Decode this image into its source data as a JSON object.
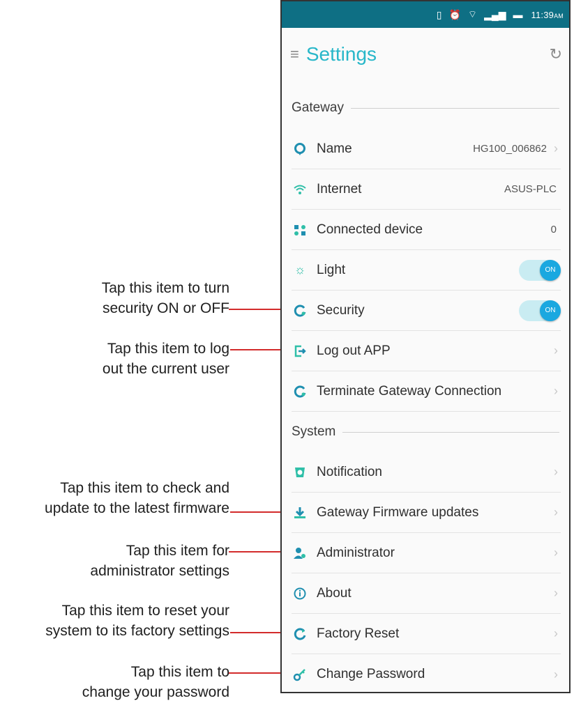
{
  "status_bar": {
    "time": "11:39",
    "ampm": "AM",
    "icons": [
      "vibrate-icon",
      "alarm-icon",
      "wifi-icon",
      "signal-icon",
      "battery-icon"
    ]
  },
  "app_bar": {
    "title": "Settings"
  },
  "sections": {
    "gateway": {
      "title": "Gateway",
      "items": [
        {
          "label": "Name",
          "value": "HG100_006862"
        },
        {
          "label": "Internet",
          "value": "ASUS-PLC"
        },
        {
          "label": "Connected device",
          "value": "0"
        },
        {
          "label": "Light",
          "toggle": "ON"
        },
        {
          "label": "Security",
          "toggle": "ON"
        },
        {
          "label": "Log out APP"
        },
        {
          "label": "Terminate Gateway Connection"
        }
      ]
    },
    "system": {
      "title": "System",
      "items": [
        {
          "label": "Notification"
        },
        {
          "label": "Gateway Firmware updates"
        },
        {
          "label": "Administrator"
        },
        {
          "label": "About"
        },
        {
          "label": "Factory Reset"
        },
        {
          "label": "Change Password"
        }
      ]
    }
  },
  "callouts": {
    "security": [
      "Tap this item to turn",
      "security ON or OFF"
    ],
    "logout": [
      "Tap this item to log",
      "out the current user"
    ],
    "firmware": [
      "Tap this item to check and",
      "update to the latest firmware"
    ],
    "admin": [
      "Tap this item for",
      "administrator settings"
    ],
    "reset": [
      "Tap this item to reset your",
      "system to its factory settings"
    ],
    "password": [
      "Tap this item to",
      "change your password"
    ]
  },
  "colors": {
    "status_bar": "#0e6f84",
    "accent": "#28b7c9",
    "callout_line": "#d32b2b",
    "toggle_on": "#1aa8e0"
  }
}
